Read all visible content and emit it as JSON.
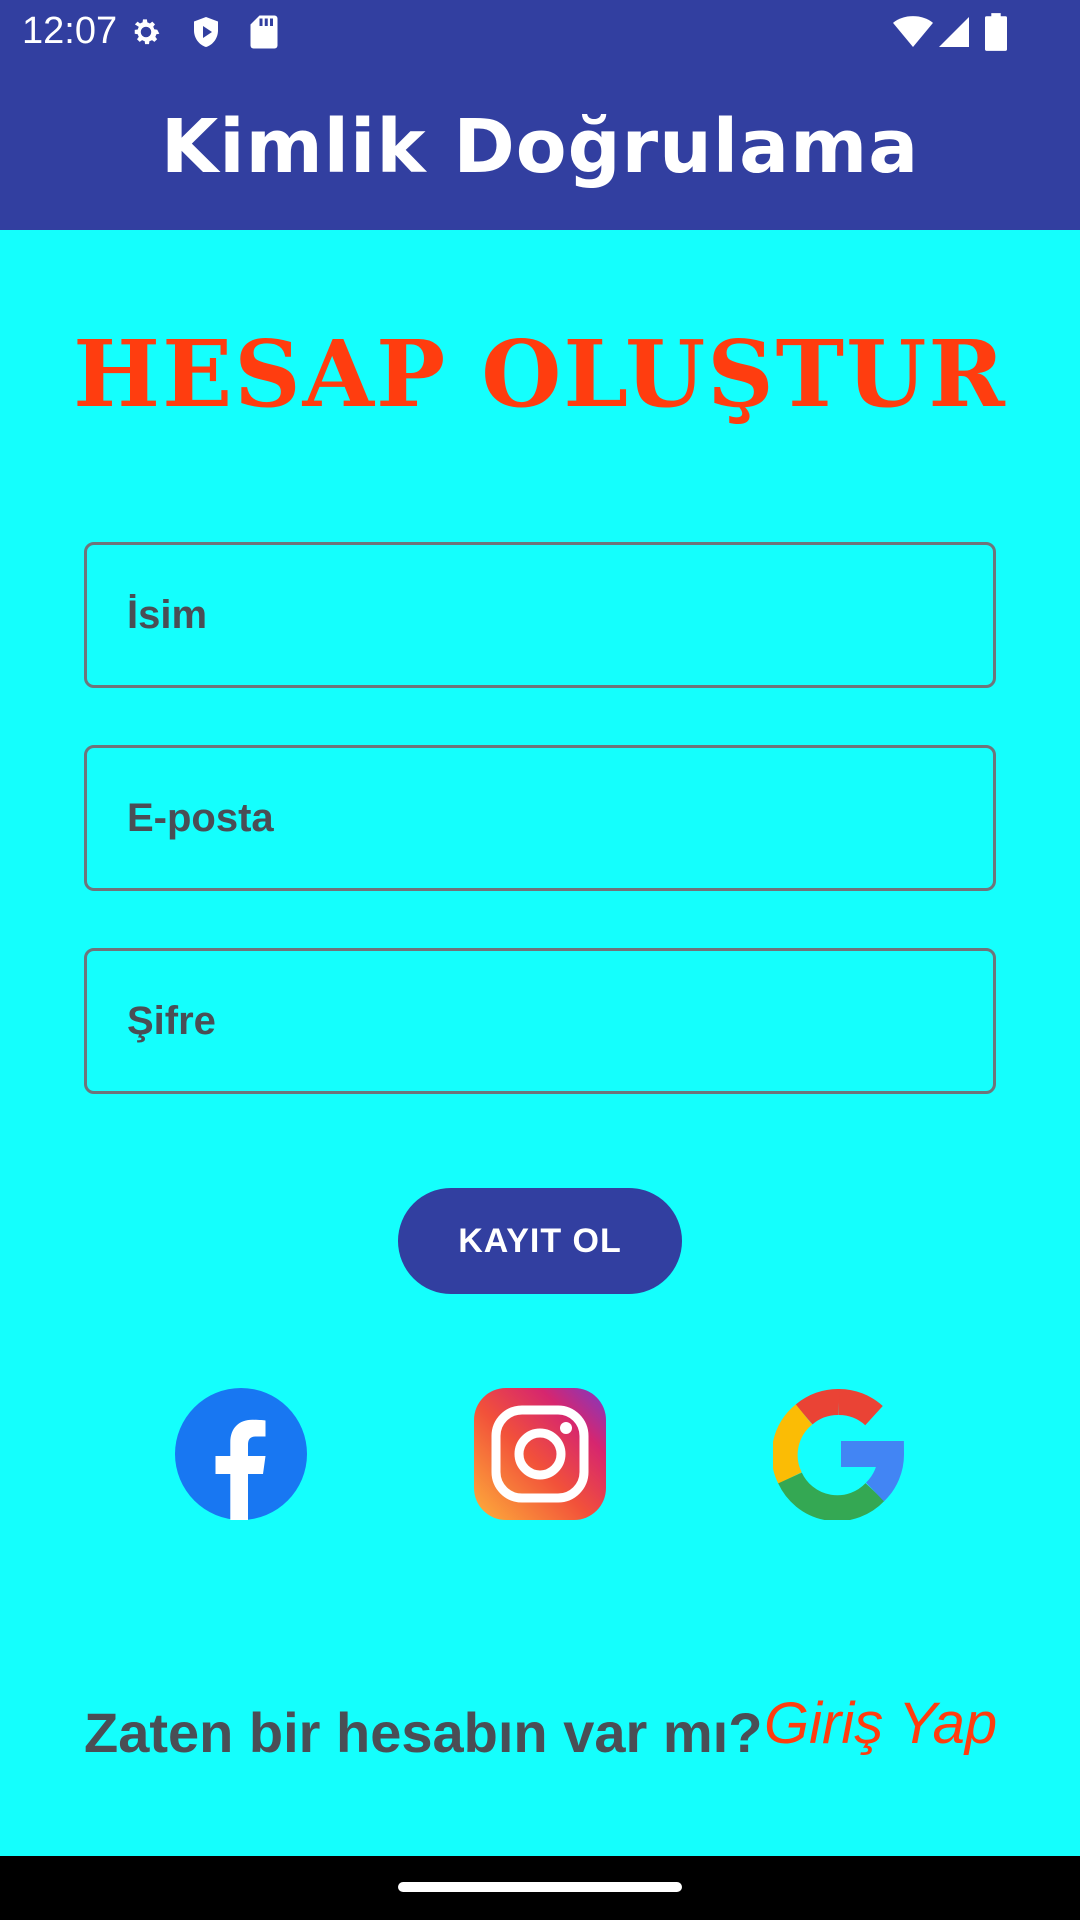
{
  "status_bar": {
    "time": "12:07",
    "left_icons": [
      "gear-icon",
      "shield-play-icon",
      "sd-card-icon"
    ],
    "right_icons": [
      "wifi-icon",
      "signal-icon",
      "battery-icon"
    ]
  },
  "app_bar": {
    "title": "Kimlik Doğrulama",
    "color": "#323fa0"
  },
  "form": {
    "heading": "HESAP OLUŞTUR",
    "name_placeholder": "İsim",
    "email_placeholder": "E-posta",
    "password_placeholder": "Şifre",
    "register_label": "KAYIT OL"
  },
  "social": [
    "facebook-icon",
    "instagram-icon",
    "google-icon"
  ],
  "footer": {
    "question": "Zaten bir hesabın var mı?",
    "login_link": "Giriş Yap"
  },
  "colors": {
    "background": "#14fffd",
    "accent": "#ff3d0f",
    "primary": "#323fa0",
    "text": "#4a4e55"
  }
}
